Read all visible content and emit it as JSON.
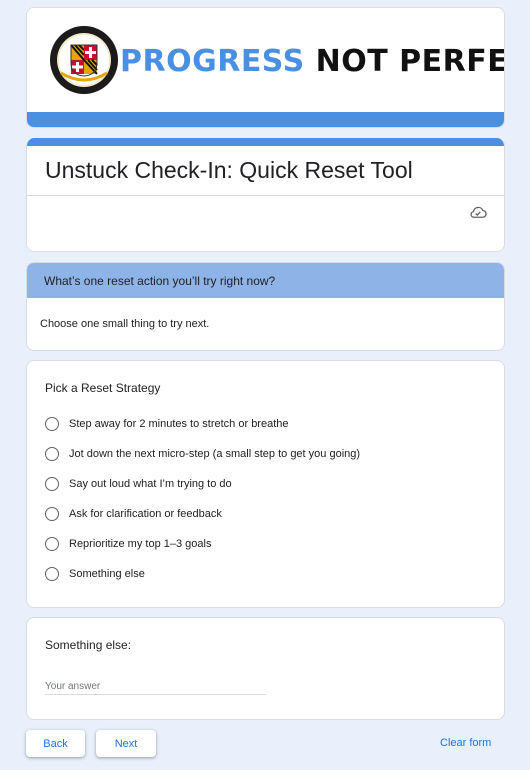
{
  "banner": {
    "word1": "PROGRESS",
    "word2": "NOT PERFECTION",
    "seal_icon": "county-seal-icon"
  },
  "form": {
    "title": "Unstuck Check-In: Quick Reset Tool",
    "cloud_icon": "cloud-saved-icon"
  },
  "section": {
    "title": "What’s one reset action you’ll try right now?",
    "description": "Choose one small thing to try next."
  },
  "question": {
    "title": "Pick a Reset Strategy",
    "options": [
      "Step away for 2 minutes to stretch or breathe",
      "Jot down the next micro-step (a small step to get you going)",
      "Say out loud what I’m trying to do",
      "Ask for clarification or feedback",
      "Reprioritize my top 1–3 goals",
      "Something else"
    ]
  },
  "else_question": {
    "title": "Something else:",
    "placeholder": "Your answer",
    "value": ""
  },
  "nav": {
    "back_label": "Back",
    "next_label": "Next",
    "clear_label": "Clear form"
  },
  "colors": {
    "accent": "#4a90e2",
    "section_header": "#8eb3e6",
    "page_bg": "#e9f0fb",
    "link": "#1a73e8"
  }
}
